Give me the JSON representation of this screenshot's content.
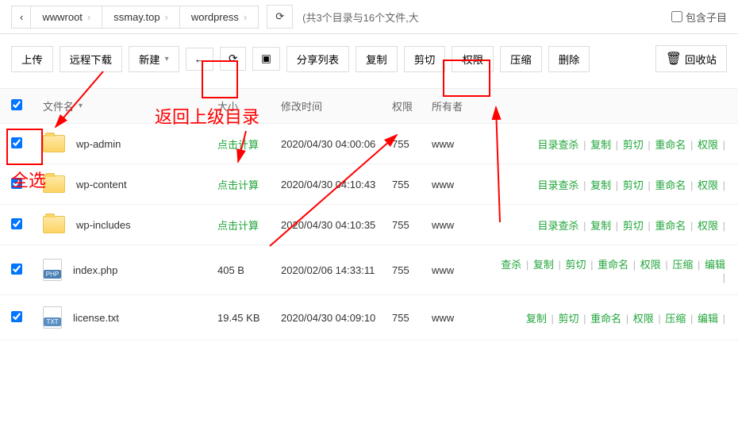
{
  "topbar": {
    "back_aria": "返回",
    "crumbs": [
      "wwwroot",
      "ssmay.top",
      "wordpress"
    ],
    "refresh_aria": "刷新",
    "info": "(共3个目录与16个文件,大",
    "include_subdir_label": "包含子目"
  },
  "toolbar": {
    "upload": "上传",
    "remote_download": "远程下载",
    "new": "新建",
    "back_aria": "返回",
    "refresh_aria": "刷新",
    "terminal_aria": "终端",
    "share_list": "分享列表",
    "copy": "复制",
    "cut": "剪切",
    "perm": "权限",
    "compress": "压缩",
    "delete": "删除",
    "recycle": "回收站"
  },
  "annotations": {
    "back_dir": "返回上级目录",
    "select_all": "全选"
  },
  "thead": {
    "filename": "文件名",
    "size": "大小",
    "mtime": "修改时间",
    "perm": "权限",
    "owner": "所有者"
  },
  "rows": [
    {
      "checked": true,
      "type": "folder",
      "name": "wp-admin",
      "size_link": "点击计算",
      "mtime": "2020/04/30 04:00:06",
      "perm": "755",
      "owner": "www",
      "actions": [
        "目录查杀",
        "复制",
        "剪切",
        "重命名",
        "权限"
      ]
    },
    {
      "checked": true,
      "type": "folder",
      "name": "wp-content",
      "size_link": "点击计算",
      "mtime": "2020/04/30 04:10:43",
      "perm": "755",
      "owner": "www",
      "actions": [
        "目录查杀",
        "复制",
        "剪切",
        "重命名",
        "权限"
      ]
    },
    {
      "checked": true,
      "type": "folder",
      "name": "wp-includes",
      "size_link": "点击计算",
      "mtime": "2020/04/30 04:10:35",
      "perm": "755",
      "owner": "www",
      "actions": [
        "目录查杀",
        "复制",
        "剪切",
        "重命名",
        "权限"
      ]
    },
    {
      "checked": true,
      "type": "php",
      "name": "index.php",
      "size": "405 B",
      "mtime": "2020/02/06 14:33:11",
      "perm": "755",
      "owner": "www",
      "actions": [
        "查杀",
        "复制",
        "剪切",
        "重命名",
        "权限",
        "压缩",
        "编辑"
      ]
    },
    {
      "checked": true,
      "type": "txt",
      "name": "license.txt",
      "size": "19.45 KB",
      "mtime": "2020/04/30 04:09:10",
      "perm": "755",
      "owner": "www",
      "actions": [
        "复制",
        "剪切",
        "重命名",
        "权限",
        "压缩",
        "编辑"
      ]
    }
  ]
}
